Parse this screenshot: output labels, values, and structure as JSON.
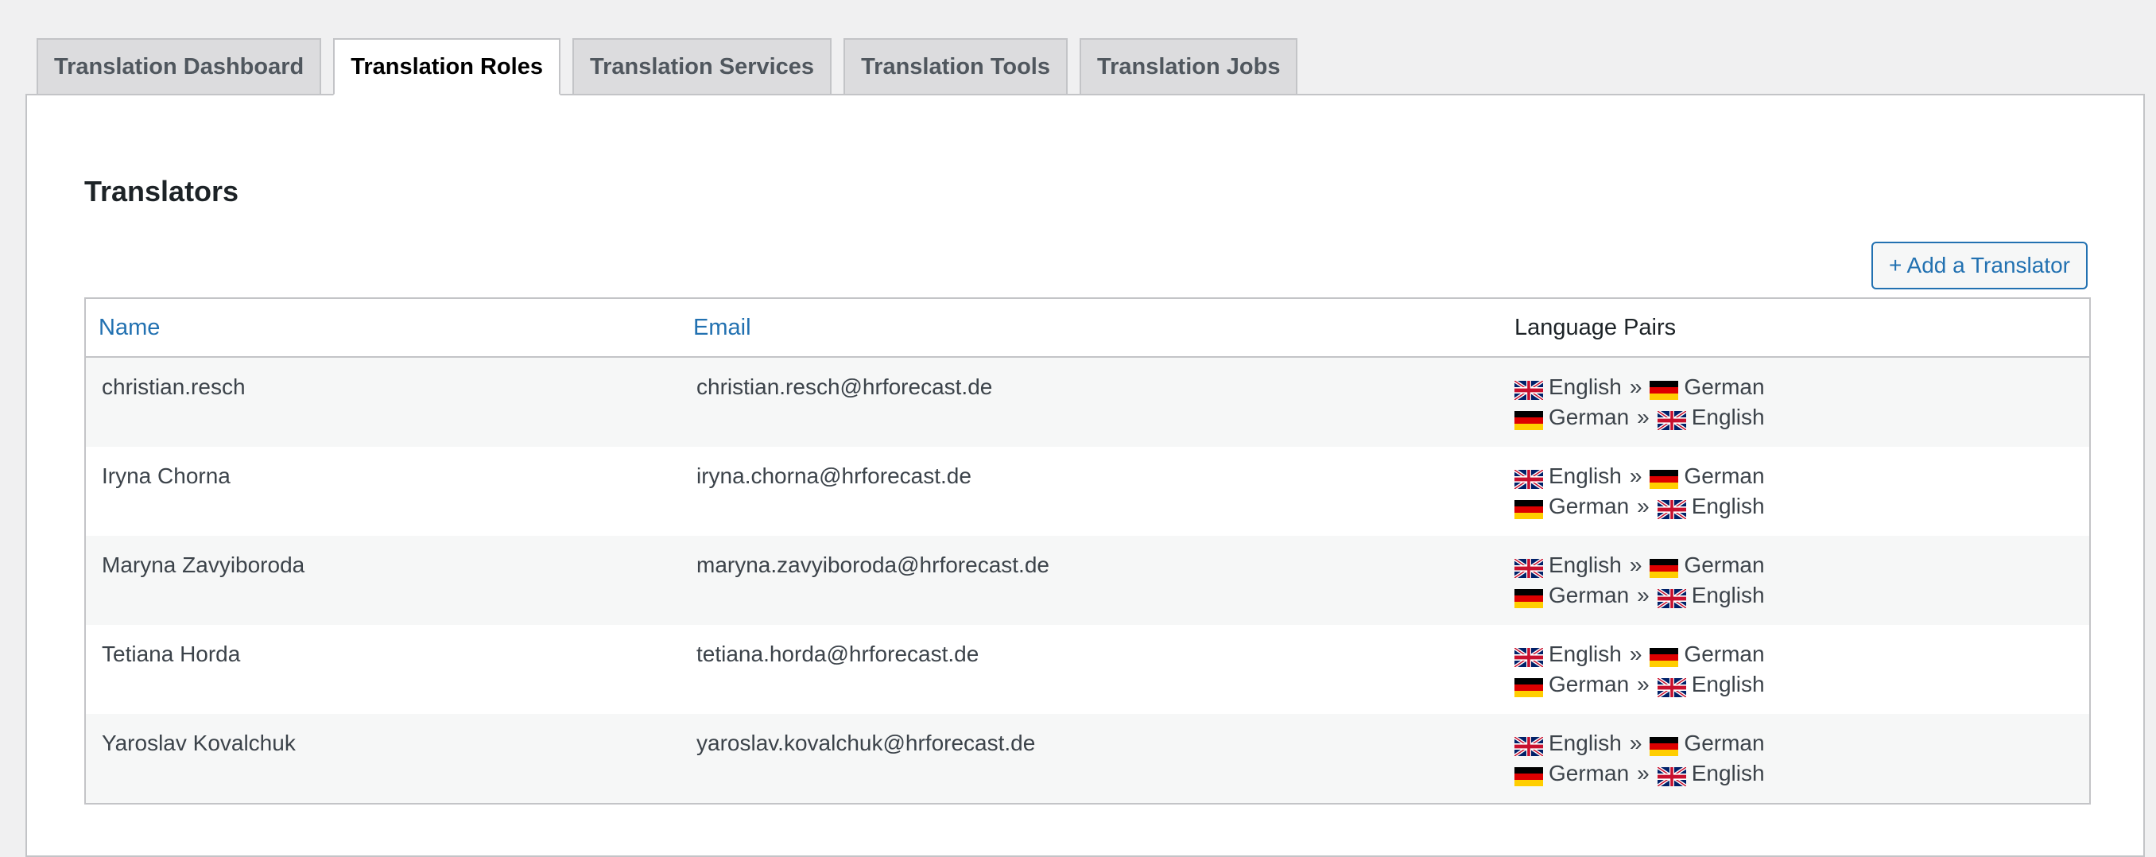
{
  "tabs": [
    {
      "label": "Translation Dashboard",
      "active": false
    },
    {
      "label": "Translation Roles",
      "active": true
    },
    {
      "label": "Translation Services",
      "active": false
    },
    {
      "label": "Translation Tools",
      "active": false
    },
    {
      "label": "Translation Jobs",
      "active": false
    }
  ],
  "section": {
    "title": "Translators",
    "add_button": "+ Add a Translator"
  },
  "table": {
    "headers": {
      "name": "Name",
      "email": "Email",
      "pairs": "Language Pairs"
    },
    "separator": "»",
    "rows": [
      {
        "name": "christian.resch",
        "email": "christian.resch@hrforecast.de",
        "pairs": [
          {
            "from": "English",
            "from_flag": "uk-flag-icon",
            "to": "German",
            "to_flag": "germany-flag-icon"
          },
          {
            "from": "German",
            "from_flag": "germany-flag-icon",
            "to": "English",
            "to_flag": "uk-flag-icon"
          }
        ]
      },
      {
        "name": "Iryna Chorna",
        "email": "iryna.chorna@hrforecast.de",
        "pairs": [
          {
            "from": "English",
            "from_flag": "uk-flag-icon",
            "to": "German",
            "to_flag": "germany-flag-icon"
          },
          {
            "from": "German",
            "from_flag": "germany-flag-icon",
            "to": "English",
            "to_flag": "uk-flag-icon"
          }
        ]
      },
      {
        "name": "Maryna Zavyiboroda",
        "email": "maryna.zavyiboroda@hrforecast.de",
        "pairs": [
          {
            "from": "English",
            "from_flag": "uk-flag-icon",
            "to": "German",
            "to_flag": "germany-flag-icon"
          },
          {
            "from": "German",
            "from_flag": "germany-flag-icon",
            "to": "English",
            "to_flag": "uk-flag-icon"
          }
        ]
      },
      {
        "name": "Tetiana Horda",
        "email": "tetiana.horda@hrforecast.de",
        "pairs": [
          {
            "from": "English",
            "from_flag": "uk-flag-icon",
            "to": "German",
            "to_flag": "germany-flag-icon"
          },
          {
            "from": "German",
            "from_flag": "germany-flag-icon",
            "to": "English",
            "to_flag": "uk-flag-icon"
          }
        ]
      },
      {
        "name": "Yaroslav Kovalchuk",
        "email": "yaroslav.kovalchuk@hrforecast.de",
        "pairs": [
          {
            "from": "English",
            "from_flag": "uk-flag-icon",
            "to": "German",
            "to_flag": "germany-flag-icon"
          },
          {
            "from": "German",
            "from_flag": "germany-flag-icon",
            "to": "English",
            "to_flag": "uk-flag-icon"
          }
        ]
      }
    ]
  },
  "colors": {
    "accent": "#2271b1",
    "background": "#f0f0f1",
    "border": "#c3c4c7"
  }
}
